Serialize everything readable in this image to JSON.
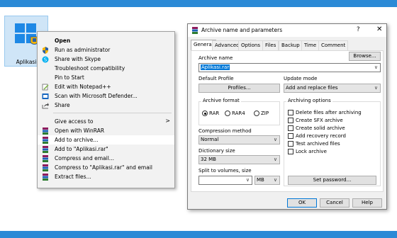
{
  "colors": {
    "accent": "#2b8ad6",
    "selection": "#0078d7",
    "winrar_red": "#b01b1b"
  },
  "desktop": {
    "icon_label": "Aplikasi"
  },
  "context_menu": {
    "items": [
      {
        "label": "Open",
        "icon": "none"
      },
      {
        "label": "Run as administrator",
        "icon": "shield-icon"
      },
      {
        "label": "Share with Skype",
        "icon": "skype-icon"
      },
      {
        "label": "Troubleshoot compatibility",
        "icon": "none"
      },
      {
        "label": "Pin to Start",
        "icon": "none"
      },
      {
        "label": "Edit with Notepad++",
        "icon": "notepad-icon"
      },
      {
        "label": "Scan with Microsoft Defender...",
        "icon": "defender-icon"
      },
      {
        "label": "Share",
        "icon": "share-icon"
      },
      {
        "label": "Give access to",
        "icon": "none",
        "submenu_arrow": ">"
      },
      {
        "label": "Open with WinRAR",
        "icon": "winrar-icon"
      },
      {
        "label": "Add to archive...",
        "icon": "winrar-icon"
      },
      {
        "label": "Add to \"Aplikasi.rar\"",
        "icon": "winrar-icon"
      },
      {
        "label": "Compress and email...",
        "icon": "winrar-icon"
      },
      {
        "label": "Compress to \"Aplikasi.rar\" and email",
        "icon": "winrar-icon"
      },
      {
        "label": "Extract files...",
        "icon": "winrar-icon"
      }
    ]
  },
  "dialog": {
    "title": "Archive name and parameters",
    "help": "?",
    "close": "✕",
    "tabs": [
      "General",
      "Advanced",
      "Options",
      "Files",
      "Backup",
      "Time",
      "Comment"
    ],
    "archive_name_label": "Archive name",
    "archive_name_value": "Aplikasi.rar",
    "browse_button": "Browse...",
    "default_profile_label": "Default Profile",
    "profiles_button": "Profiles...",
    "update_mode_label": "Update mode",
    "update_mode_value": "Add and replace files",
    "archive_format_label": "Archive format",
    "formats": [
      "RAR",
      "RAR4",
      "ZIP"
    ],
    "compression_label": "Compression method",
    "compression_value": "Normal",
    "dictionary_label": "Dictionary size",
    "dictionary_value": "32 MB",
    "split_label": "Split to volumes, size",
    "split_unit": "MB",
    "archiving_options_label": "Archiving options",
    "options": [
      "Delete files after archiving",
      "Create SFX archive",
      "Create solid archive",
      "Add recovery record",
      "Test archived files",
      "Lock archive"
    ],
    "set_password_button": "Set password...",
    "ok_button": "OK",
    "cancel_button": "Cancel",
    "help_button": "Help"
  }
}
